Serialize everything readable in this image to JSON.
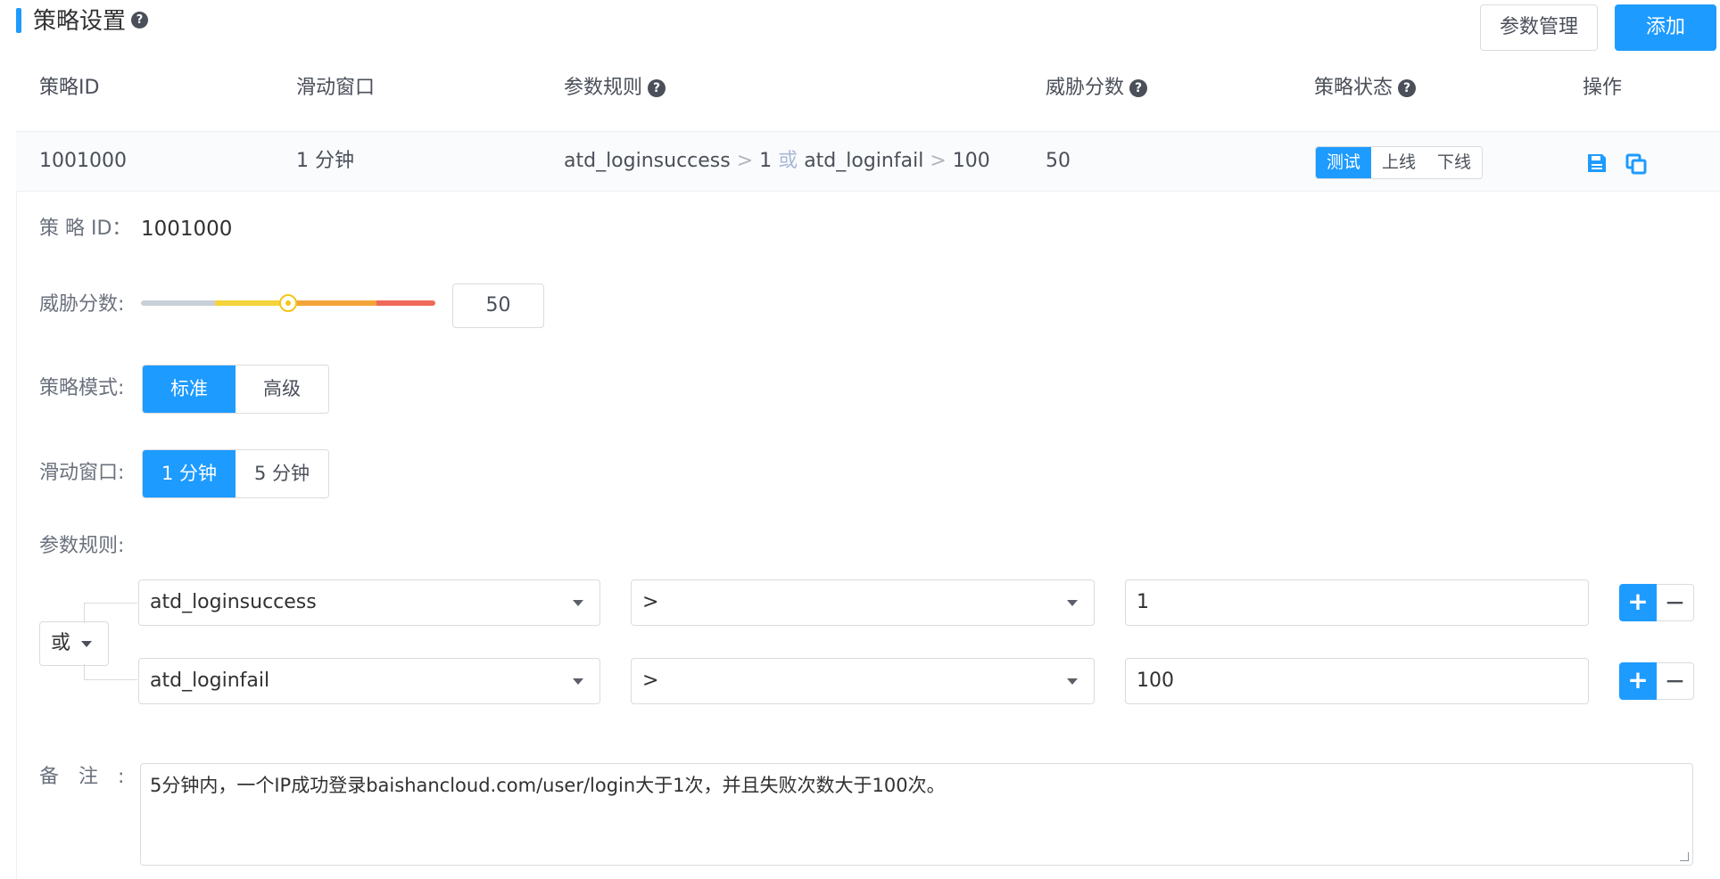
{
  "header": {
    "title": "策略设置",
    "help": "?",
    "param_btn": "参数管理",
    "add_btn": "添加"
  },
  "table": {
    "columns": [
      "策略ID",
      "滑动窗口",
      "参数规则",
      "威胁分数",
      "策略状态",
      "操作"
    ],
    "row": {
      "id": "1001000",
      "window": "1 分钟",
      "rule": {
        "p1": "atd_loginsuccess",
        "op1": ">",
        "v1": "1",
        "conj": "或",
        "p2": "atd_loginfail",
        "op2": ">",
        "v2": "100"
      },
      "score": "50",
      "status_options": [
        "测试",
        "上线",
        "下线"
      ],
      "status_active": "测试",
      "actions": [
        "save-icon",
        "copy-icon"
      ]
    }
  },
  "detail": {
    "id_label": "策 略 ID：",
    "id_value": "1001000",
    "score_label": "威胁分数:",
    "score_value": "50",
    "score_fraction": 0.5,
    "mode_label": "策略模式:",
    "mode_options": [
      "标准",
      "高级"
    ],
    "mode_active": "标准",
    "window_label": "滑动窗口:",
    "window_options": [
      "1 分钟",
      "5 分钟"
    ],
    "window_active": "1 分钟",
    "rules_label": "参数规则:",
    "conj_value": "或",
    "rules": [
      {
        "param": "atd_loginsuccess",
        "op": ">",
        "value": "1"
      },
      {
        "param": "atd_loginfail",
        "op": ">",
        "value": "100"
      }
    ],
    "plus": "+",
    "minus": "−",
    "remark_label": "备　注　:",
    "remark_value": "5分钟内，一个IP成功登录baishancloud.com/user/login大于1次，并且失败次数大于100次。"
  },
  "colors": {
    "accent": "#1e9bff",
    "slider": [
      "#c9cfd8",
      "#f5d33a",
      "#f3a53a",
      "#ef6a5a"
    ]
  }
}
